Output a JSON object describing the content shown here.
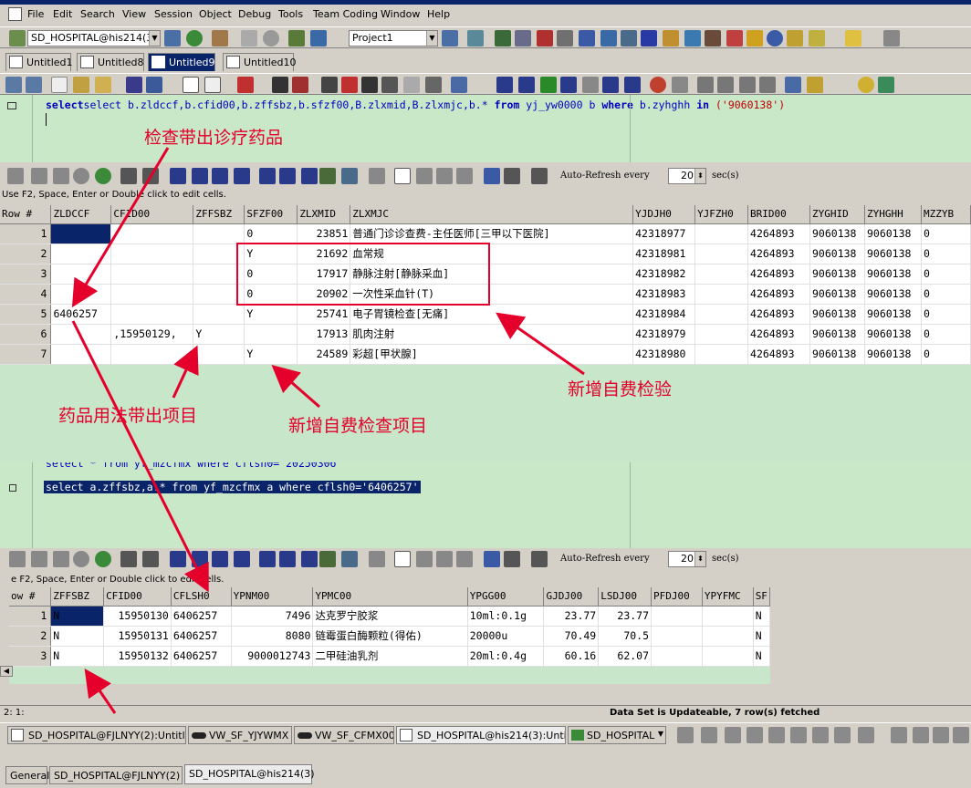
{
  "menu": [
    "File",
    "Edit",
    "Search",
    "View",
    "Session",
    "Object",
    "Debug",
    "Tools",
    "Team Coding",
    "Window",
    "Help"
  ],
  "session_combo": "SD_HOSPITAL@his214(3)",
  "project_combo": "Project1",
  "doc_tabs": [
    "Untitled1",
    "Untitled8",
    "Untitled9",
    "Untitled10"
  ],
  "editor1": {
    "line1_a": "select b.zldccf,b.cfid00,b.zffsbz,b.sfzf00,B.zlxmid,B.zlxmjc,b.* ",
    "from": "from",
    "line1_b": " yj_yw0000 b ",
    "where": "where",
    "line1_c": " b.zyhghh ",
    "in": "in",
    "line1_d": " ('9060138')"
  },
  "auto_refresh": {
    "label": "Auto-Refresh every",
    "value": "20",
    "unit": "sec(s)"
  },
  "grid_hint1": "Use F2, Space, Enter or Double click to edit cells.",
  "grid1": {
    "columns": [
      "Row #",
      "ZLDCCF",
      "CFID00",
      "ZFFSBZ",
      "SFZF00",
      "ZLXMID",
      "ZLXMJC",
      "YJDJH0",
      "YJFZH0",
      "BRID00",
      "ZYGHID",
      "ZYHGHH",
      "MZZYB"
    ],
    "rows": [
      [
        "1",
        "",
        "",
        "",
        "0",
        "23851",
        "普通门诊诊查费-主任医师[三甲以下医院]",
        "42318977",
        "",
        "4264893",
        "9060138",
        "9060138",
        "0"
      ],
      [
        "2",
        "",
        "",
        "",
        "Y",
        "21692",
        "血常规",
        "42318981",
        "",
        "4264893",
        "9060138",
        "9060138",
        "0"
      ],
      [
        "3",
        "",
        "",
        "",
        "0",
        "17917",
        "静脉注射[静脉采血]",
        "42318982",
        "",
        "4264893",
        "9060138",
        "9060138",
        "0"
      ],
      [
        "4",
        "",
        "",
        "",
        "0",
        "20902",
        "一次性采血针(T)",
        "42318983",
        "",
        "4264893",
        "9060138",
        "9060138",
        "0"
      ],
      [
        "5",
        "6406257",
        "",
        "",
        "Y",
        "25741",
        "电子胃镜检查[无痛]",
        "42318984",
        "",
        "4264893",
        "9060138",
        "9060138",
        "0"
      ],
      [
        "6",
        "",
        ",15950129,",
        "Y",
        "",
        "17913",
        "肌肉注射",
        "42318979",
        "",
        "4264893",
        "9060138",
        "9060138",
        "0"
      ],
      [
        "7",
        "",
        "",
        "",
        "Y",
        "24589",
        "彩超[甲状腺]",
        "42318980",
        "",
        "4264893",
        "9060138",
        "9060138",
        "0"
      ]
    ]
  },
  "editor2": {
    "line0": "select * from yf_mzcfmx where cflsh0='20250306'",
    "line1": "select a.zffsbz,a.* from yf_mzcfmx a where cflsh0='6406257'"
  },
  "grid_hint2": "e F2, Space, Enter or Double click to edit cells.",
  "grid2": {
    "columns": [
      "ow #",
      "ZFFSBZ",
      "CFID00",
      "CFLSH0",
      "YPNM00",
      "YPMC00",
      "YPGG00",
      "GJDJ00",
      "LSDJ00",
      "PFDJ00",
      "YPYFMC",
      "SF"
    ],
    "rows": [
      [
        "1",
        "N",
        "15950130",
        "6406257",
        "7496",
        "达克罗宁胶浆",
        "10ml:0.1g",
        "23.77",
        "23.77",
        "",
        "",
        "N"
      ],
      [
        "2",
        "N",
        "15950131",
        "6406257",
        "8080",
        "链霉蛋白酶颗粒(得佑)",
        "20000u",
        "70.49",
        "70.5",
        "",
        "",
        "N"
      ],
      [
        "3",
        "N",
        "15950132",
        "6406257",
        "9000012743",
        "二甲硅油乳剂",
        "20ml:0.4g",
        "60.16",
        "62.07",
        "",
        "",
        "N"
      ]
    ]
  },
  "status_bar": {
    "pos": "2:  1:",
    "fetched": "Data Set is Updateable, 7 row(s) fetched"
  },
  "task_tabs": [
    "SD_HOSPITAL@FJLNYY(2):Untitl...",
    "VW_SF_YJYWMX",
    "VW_SF_CFMX00",
    "SD_HOSPITAL@his214(3):Untitl...",
    "SD_HOSPITAL"
  ],
  "bottom_tabs": [
    "General",
    "SD_HOSPITAL@FJLNYY(2)",
    "SD_HOSPITAL@his214(3)"
  ],
  "annotations": {
    "a1": "检查带出诊疗药品",
    "a2": "新增自费检验",
    "a3": "药品用法带出项目",
    "a4": "新增自费检查项目"
  },
  "colors": {
    "annotation": "#e4002b",
    "grid_bg": "#c8e6c9",
    "selection": "#0a246a",
    "chrome": "#d4d0c8"
  }
}
